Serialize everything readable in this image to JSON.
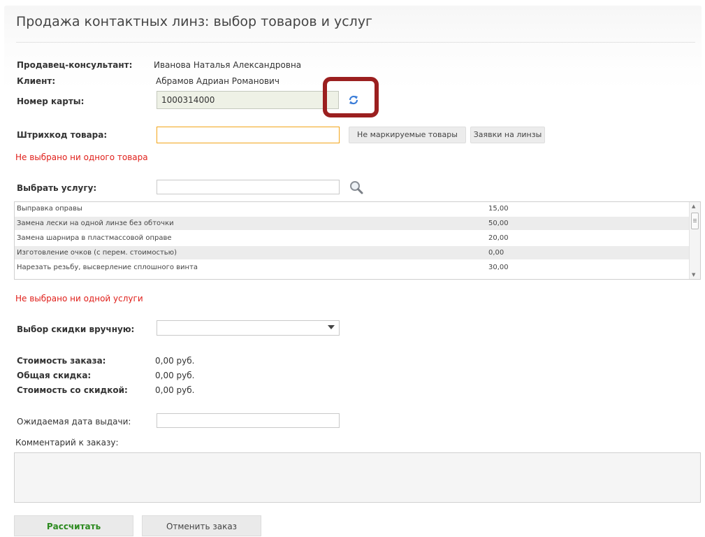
{
  "page": {
    "title": "Продажа контактных линз: выбор товаров и услуг"
  },
  "info": {
    "seller_label": "Продавец-консультант:",
    "seller_value": "Иванова Наталья Александровна",
    "client_label": "Клиент:",
    "client_value": "Абрамов Адриан Романович",
    "card_label": "Номер карты:",
    "card_value": "1000314000",
    "refresh_icon": "refresh-icon"
  },
  "barcode": {
    "label": "Штрихкод товара:",
    "value": "",
    "unmarked_button": "Не маркируемые товары",
    "orders_button": "Заявки на линзы",
    "error": "Не выбрано ни одного товара"
  },
  "service": {
    "label": "Выбрать услугу:",
    "value": "",
    "search_icon": "magnifier-icon",
    "rows": [
      {
        "name": "Выправка оправы",
        "price": "15,00"
      },
      {
        "name": "Замена лески на одной линзе без обточки",
        "price": "50,00"
      },
      {
        "name": "Замена шарнира в пластмассовой оправе",
        "price": "20,00"
      },
      {
        "name": "Изготовление очков (с перем. стоимостью)",
        "price": "0,00"
      },
      {
        "name": "Нарезать резьбу, высверление сплошного винта",
        "price": "30,00"
      }
    ],
    "error": "Не выбрано ни одной услуги"
  },
  "discount": {
    "label": "Выбор скидки вручную:",
    "value": ""
  },
  "totals": {
    "order_cost_label": "Стоимость заказа:",
    "order_cost_value": "0,00 руб.",
    "total_discount_label": "Общая скидка:",
    "total_discount_value": "0,00 руб.",
    "discounted_cost_label": "Стоимость со скидкой:",
    "discounted_cost_value": "0,00 руб."
  },
  "delivery": {
    "label": "Ожидаемая дата выдачи:",
    "value": ""
  },
  "comment": {
    "label": "Комментарий к заказу:",
    "value": ""
  },
  "actions": {
    "calculate": "Рассчитать",
    "cancel": "Отменить заказ"
  },
  "colors": {
    "error": "#e0201b",
    "calculate_text": "#2c8a1f",
    "highlight_box": "#9b1f1f",
    "barcode_focus_border": "#f3a51a"
  }
}
